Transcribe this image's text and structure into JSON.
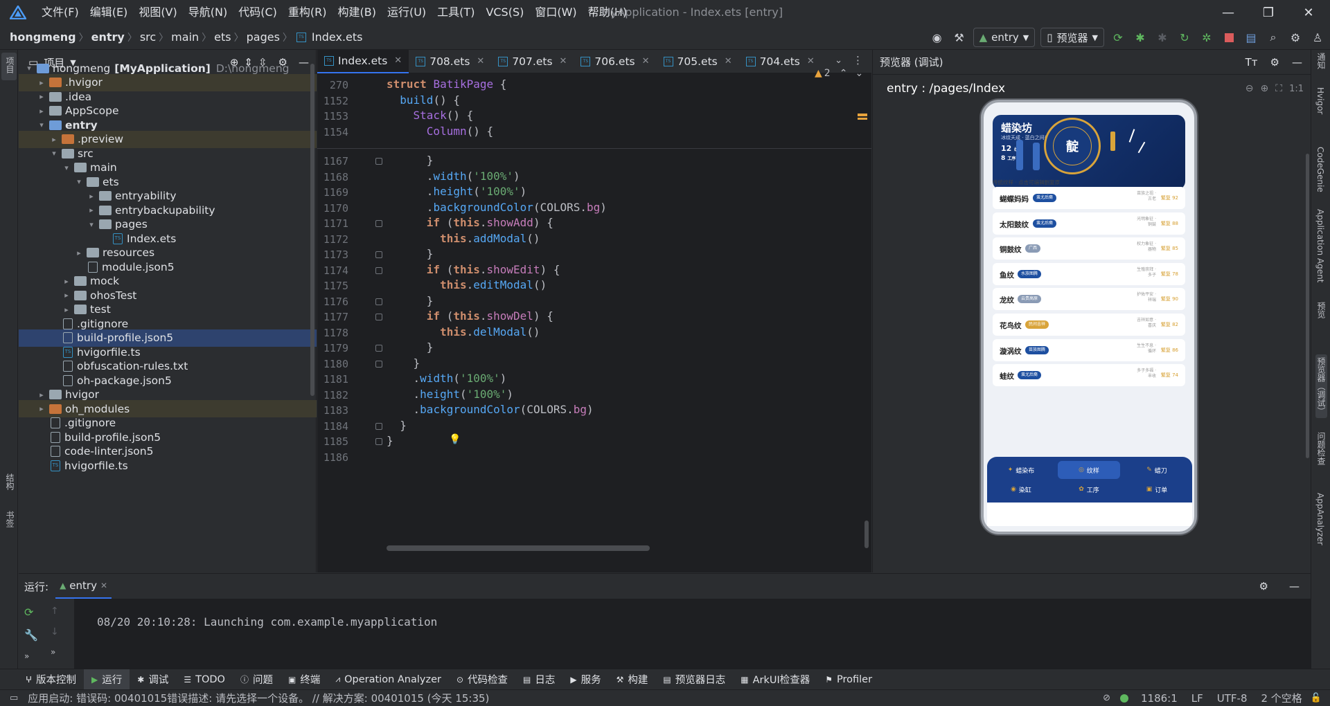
{
  "app": {
    "window_title": "MyApplication - Index.ets [entry]"
  },
  "menu": [
    "文件(F)",
    "编辑(E)",
    "视图(V)",
    "导航(N)",
    "代码(C)",
    "重构(R)",
    "构建(B)",
    "运行(U)",
    "工具(T)",
    "VCS(S)",
    "窗口(W)",
    "帮助(H)"
  ],
  "breadcrumb": [
    "hongmeng",
    "entry",
    "src",
    "main",
    "ets",
    "pages",
    "Index.ets"
  ],
  "toolbar": {
    "run_config": "entry",
    "device": "预览器"
  },
  "left_strip": {
    "project": "项目",
    "structure": "结构",
    "bookmarks": "书签"
  },
  "right_strip": [
    "通知",
    "Hvigor",
    "CodeGenie",
    "Application Agent",
    "预览",
    "预览器（调试）",
    "问题检查",
    "AppAnalyzer"
  ],
  "project": {
    "title": "项目",
    "tree": [
      {
        "label": "hongmeng",
        "bold": "[MyApplication]",
        "path": "D:\\hongmeng",
        "depth": 0,
        "kind": "folder-b",
        "arrow": "▾"
      },
      {
        "label": ".hvigor",
        "depth": 1,
        "kind": "folder-o",
        "arrow": "▸",
        "excl": true
      },
      {
        "label": ".idea",
        "depth": 1,
        "kind": "folder-g",
        "arrow": "▸"
      },
      {
        "label": "AppScope",
        "depth": 1,
        "kind": "folder-g",
        "arrow": "▸"
      },
      {
        "label": "entry",
        "depth": 1,
        "kind": "folder-b",
        "arrow": "▾",
        "boldrow": true
      },
      {
        "label": ".preview",
        "depth": 2,
        "kind": "folder-o",
        "arrow": "▸",
        "excl": true
      },
      {
        "label": "src",
        "depth": 2,
        "kind": "folder-g",
        "arrow": "▾"
      },
      {
        "label": "main",
        "depth": 3,
        "kind": "folder-g",
        "arrow": "▾"
      },
      {
        "label": "ets",
        "depth": 4,
        "kind": "folder-g",
        "arrow": "▾"
      },
      {
        "label": "entryability",
        "depth": 5,
        "kind": "folder-g",
        "arrow": "▸"
      },
      {
        "label": "entrybackupability",
        "depth": 5,
        "kind": "folder-g",
        "arrow": "▸"
      },
      {
        "label": "pages",
        "depth": 5,
        "kind": "folder-g",
        "arrow": "▾"
      },
      {
        "label": "Index.ets",
        "depth": 6,
        "kind": "file-ts",
        "arrow": ""
      },
      {
        "label": "resources",
        "depth": 4,
        "kind": "folder-g",
        "arrow": "▸"
      },
      {
        "label": "module.json5",
        "depth": 4,
        "kind": "file",
        "arrow": ""
      },
      {
        "label": "mock",
        "depth": 3,
        "kind": "folder-g",
        "arrow": "▸"
      },
      {
        "label": "ohosTest",
        "depth": 3,
        "kind": "folder-g",
        "arrow": "▸"
      },
      {
        "label": "test",
        "depth": 3,
        "kind": "folder-g",
        "arrow": "▸"
      },
      {
        "label": ".gitignore",
        "depth": 2,
        "kind": "file",
        "arrow": ""
      },
      {
        "label": "build-profile.json5",
        "depth": 2,
        "kind": "file",
        "arrow": "",
        "selected": true
      },
      {
        "label": "hvigorfile.ts",
        "depth": 2,
        "kind": "file-ts",
        "arrow": ""
      },
      {
        "label": "obfuscation-rules.txt",
        "depth": 2,
        "kind": "file",
        "arrow": ""
      },
      {
        "label": "oh-package.json5",
        "depth": 2,
        "kind": "file",
        "arrow": ""
      },
      {
        "label": "hvigor",
        "depth": 1,
        "kind": "folder-g",
        "arrow": "▸"
      },
      {
        "label": "oh_modules",
        "depth": 1,
        "kind": "folder-o",
        "arrow": "▸",
        "excl": true
      },
      {
        "label": ".gitignore",
        "depth": 1,
        "kind": "file",
        "arrow": ""
      },
      {
        "label": "build-profile.json5",
        "depth": 1,
        "kind": "file",
        "arrow": ""
      },
      {
        "label": "code-linter.json5",
        "depth": 1,
        "kind": "file",
        "arrow": ""
      },
      {
        "label": "hvigorfile.ts",
        "depth": 1,
        "kind": "file-ts",
        "arrow": ""
      }
    ]
  },
  "editor": {
    "tabs": [
      "Index.ets",
      "708.ets",
      "707.ets",
      "706.ets",
      "705.ets",
      "704.ets"
    ],
    "warnings": "2",
    "sticky": [
      {
        "n": "270",
        "html": "<span class='kw'>struct</span> <span class='ty'>BatikPage</span> {"
      },
      {
        "n": "1152",
        "html": "  <span class='fn'>build</span>() {"
      },
      {
        "n": "1153",
        "html": "    <span class='ty'>Stack</span>() {"
      },
      {
        "n": "1154",
        "html": "      <span class='ty'>Column</span>() {"
      }
    ],
    "lines": [
      {
        "n": "1167",
        "t": "      }"
      },
      {
        "n": "1168",
        "t": "      .width('100%')"
      },
      {
        "n": "1169",
        "t": "      .height('100%')"
      },
      {
        "n": "1170",
        "t": "      .backgroundColor(COLORS.bg)"
      },
      {
        "n": "1171",
        "t": "      if (this.showAdd) {"
      },
      {
        "n": "1172",
        "t": "        this.addModal()"
      },
      {
        "n": "1173",
        "t": "      }"
      },
      {
        "n": "1174",
        "t": "      if (this.showEdit) {"
      },
      {
        "n": "1175",
        "t": "        this.editModal()"
      },
      {
        "n": "1176",
        "t": "      }"
      },
      {
        "n": "1177",
        "t": "      if (this.showDel) {"
      },
      {
        "n": "1178",
        "t": "        this.delModal()"
      },
      {
        "n": "1179",
        "t": "      }"
      },
      {
        "n": "1180",
        "t": "    }"
      },
      {
        "n": "1181",
        "t": "    .width('100%')"
      },
      {
        "n": "1182",
        "t": "    .height('100%')"
      },
      {
        "n": "1183",
        "t": "    .backgroundColor(COLORS.bg)"
      },
      {
        "n": "1184",
        "t": "  }"
      },
      {
        "n": "1185",
        "t": "}"
      },
      {
        "n": "1186",
        "t": ""
      }
    ]
  },
  "preview": {
    "title": "预览器 (调试)",
    "route": "entry : /pages/Index",
    "app": {
      "banner_title": "蜡染坊",
      "banner_sub": "冰纹天成 · 蓝白之间有大美",
      "stat1": "12",
      "stat1_label": "纹样",
      "stat2": "8",
      "stat2_label": "纹样",
      "stat3": "8",
      "stat3_label": "工序",
      "stat4": "8",
      "stat4_label": "工序",
      "seal": "靛",
      "section": "传统纹样 · 点击可编辑删复原",
      "items": [
        {
          "name": "蝴蝶妈妈",
          "tag": "蚩尤后裔",
          "tag_color": "#1d4fa0",
          "note": "苗族之祖 · 古老",
          "score": "繁复 92"
        },
        {
          "name": "太阳鼓纹",
          "tag": "蚩尤后裔",
          "tag_color": "#1d4fa0",
          "note": "光明象征 · 铜鼓",
          "score": "繁复 88"
        },
        {
          "name": "铜鼓纹",
          "tag": "广西",
          "tag_color": "#8a9bb5",
          "note": "权力象征 · 器物",
          "score": "繁复 85"
        },
        {
          "name": "鱼纹",
          "tag": "水族图腾",
          "tag_color": "#1d4fa0",
          "note": "生殖崇拜 · 多子",
          "score": "繁复 78"
        },
        {
          "name": "龙纹",
          "tag": "云贵高原",
          "tag_color": "#8a9bb5",
          "note": "护佑平安 · 祥瑞",
          "score": "繁复 90"
        },
        {
          "name": "花鸟纹",
          "tag": "民间吉祥",
          "tag_color": "#d9a43a",
          "note": "吉祥如意 · 喜庆",
          "score": "繁复 82"
        },
        {
          "name": "漩涡纹",
          "tag": "苗族图腾",
          "tag_color": "#1d4fa0",
          "note": "生生不息 · 循环",
          "score": "繁复 86"
        },
        {
          "name": "蛙纹",
          "tag": "蚩尤后裔",
          "tag_color": "#1d4fa0",
          "note": "多子多福 · 丰收",
          "score": "繁复 74"
        }
      ],
      "tabs": [
        "蜡染布",
        "纹样",
        "蜡刀",
        "染缸",
        "工序",
        "订单"
      ]
    }
  },
  "run": {
    "label": "运行:",
    "config": "entry",
    "output": "08/20 20:10:28: Launching com.example.myapplication"
  },
  "tools": [
    "版本控制",
    "运行",
    "调试",
    "TODO",
    "问题",
    "终端",
    "Operation Analyzer",
    "代码检查",
    "日志",
    "服务",
    "构建",
    "预览器日志",
    "ArkUI检查器",
    "Profiler"
  ],
  "status": {
    "message": "应用启动: 错误码: 00401015错误描述: 请先选择一个设备。 // 解决方案: 00401015 (今天 15:35)",
    "position": "1186:1",
    "line_sep": "LF",
    "encoding": "UTF-8",
    "indent": "2 个空格"
  }
}
